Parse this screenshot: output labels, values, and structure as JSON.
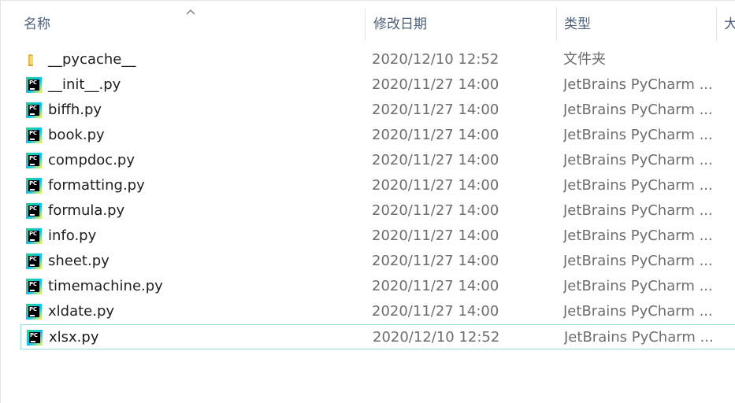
{
  "columns": {
    "name": "名称",
    "modified": "修改日期",
    "type": "类型",
    "size": "大"
  },
  "colors": {
    "header_text": "#4c607a",
    "selection_border": "#99d9d5",
    "folder": "#f8d775",
    "secondary_text": "#6d6d6d"
  },
  "files": [
    {
      "name": "__pycache__",
      "modified": "2020/12/10 12:52",
      "type": "文件夹",
      "icon": "folder-icon"
    },
    {
      "name": "__init__.py",
      "modified": "2020/11/27 14:00",
      "type": "JetBrains PyCharm ...",
      "icon": "pycharm-file-icon"
    },
    {
      "name": "biffh.py",
      "modified": "2020/11/27 14:00",
      "type": "JetBrains PyCharm ...",
      "icon": "pycharm-file-icon"
    },
    {
      "name": "book.py",
      "modified": "2020/11/27 14:00",
      "type": "JetBrains PyCharm ...",
      "icon": "pycharm-file-icon"
    },
    {
      "name": "compdoc.py",
      "modified": "2020/11/27 14:00",
      "type": "JetBrains PyCharm ...",
      "icon": "pycharm-file-icon"
    },
    {
      "name": "formatting.py",
      "modified": "2020/11/27 14:00",
      "type": "JetBrains PyCharm ...",
      "icon": "pycharm-file-icon"
    },
    {
      "name": "formula.py",
      "modified": "2020/11/27 14:00",
      "type": "JetBrains PyCharm ...",
      "icon": "pycharm-file-icon"
    },
    {
      "name": "info.py",
      "modified": "2020/11/27 14:00",
      "type": "JetBrains PyCharm ...",
      "icon": "pycharm-file-icon"
    },
    {
      "name": "sheet.py",
      "modified": "2020/11/27 14:00",
      "type": "JetBrains PyCharm ...",
      "icon": "pycharm-file-icon"
    },
    {
      "name": "timemachine.py",
      "modified": "2020/11/27 14:00",
      "type": "JetBrains PyCharm ...",
      "icon": "pycharm-file-icon"
    },
    {
      "name": "xldate.py",
      "modified": "2020/11/27 14:00",
      "type": "JetBrains PyCharm ...",
      "icon": "pycharm-file-icon"
    },
    {
      "name": "xlsx.py",
      "modified": "2020/12/10 12:52",
      "type": "JetBrains PyCharm ...",
      "icon": "pycharm-file-icon",
      "selected": true
    }
  ]
}
